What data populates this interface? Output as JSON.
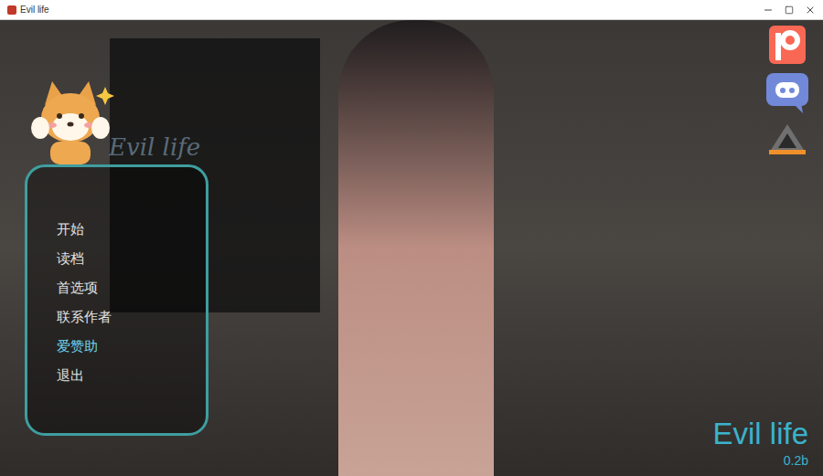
{
  "window": {
    "title": "Evil life"
  },
  "logo": {
    "text": "Evil life"
  },
  "menu": {
    "items": [
      {
        "label": "开始",
        "selected": false
      },
      {
        "label": "读档",
        "selected": false
      },
      {
        "label": "首选项",
        "selected": false
      },
      {
        "label": "联系作者",
        "selected": false
      },
      {
        "label": "爱赞助",
        "selected": true
      },
      {
        "label": "退出",
        "selected": false
      }
    ]
  },
  "game": {
    "title": "Evil life",
    "version": "0.2b"
  }
}
